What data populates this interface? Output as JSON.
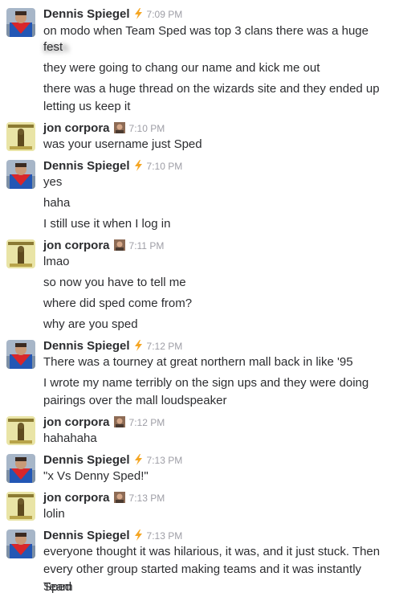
{
  "messages": [
    {
      "author": "Dennis Spiegel",
      "time": "7:09 PM",
      "lines": [
        "on modo when Team Sped was top 3 clans there was a huge",
        "fest",
        "they were going to chang our name and kick me out",
        "there was a huge thread on the wizards site and they ended up",
        "letting us keep it"
      ],
      "redacted_word": "bitch"
    },
    {
      "author": "jon corpora",
      "time": "7:10 PM",
      "lines": [
        "was your username just Sped"
      ]
    },
    {
      "author": "Dennis Spiegel",
      "time": "7:10 PM",
      "lines": [
        "yes",
        "haha",
        "I still use it when I log in"
      ]
    },
    {
      "author": "jon corpora",
      "time": "7:11 PM",
      "lines": [
        "lmao",
        "so now you have to tell me",
        "where did sped come from?",
        "why are you sped"
      ]
    },
    {
      "author": "Dennis Spiegel",
      "time": "7:12 PM",
      "lines": [
        "There was a tourney at great northern mall back in like '95",
        "I wrote my name terribly on the sign ups and they were doing",
        "pairings over the mall loudspeaker"
      ]
    },
    {
      "author": "jon corpora",
      "time": "7:12 PM",
      "lines": [
        "hahahaha"
      ]
    },
    {
      "author": "Dennis Spiegel",
      "time": "7:13 PM",
      "lines": [
        "\"x Vs Denny Sped!\""
      ]
    },
    {
      "author": "jon corpora",
      "time": "7:13 PM",
      "lines": [
        "lolin"
      ]
    },
    {
      "author": "Dennis Spiegel",
      "time": "7:13 PM",
      "lines": [
        "everyone thought it was hilarious, it was, and it just stuck. Then",
        "every other group started making teams and it was instantly Team",
        "Sped"
      ]
    }
  ],
  "colors": {
    "name": "#2c2d30",
    "text": "#2c2d30",
    "timestamp": "#9e9ea6",
    "lightning": "#f5a623"
  },
  "icons": {
    "dennis_badge": "lightning-icon",
    "jon_badge": "portrait-emoji-icon"
  }
}
